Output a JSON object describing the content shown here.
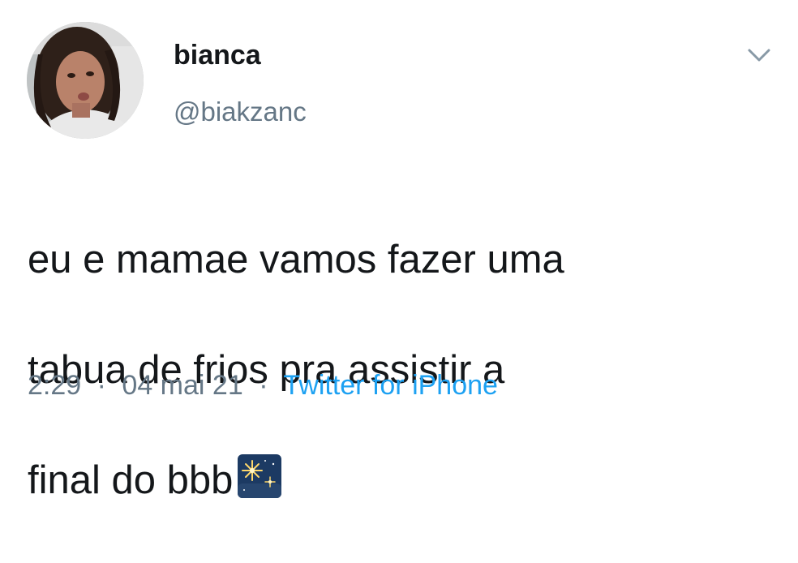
{
  "tweet": {
    "display_name": "bianca",
    "handle": "@biakzanc",
    "text_lines": [
      "eu e mamae vamos fazer uma",
      "tabua de frios pra assistir a",
      "final do bbb"
    ],
    "emoji": "sparkler-night-sky",
    "time": "2:29",
    "separator": "·",
    "date": "04 mai 21",
    "source": "Twitter for iPhone"
  },
  "colors": {
    "primary_text": "#14171a",
    "secondary_text": "#657786",
    "link": "#1da1f2",
    "background": "#ffffff"
  }
}
